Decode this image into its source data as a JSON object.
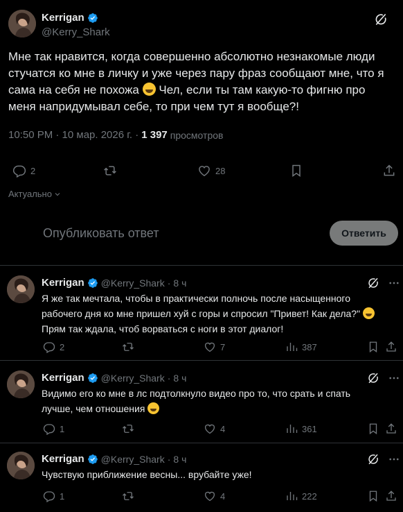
{
  "main_tweet": {
    "author_name": "Kerrigan",
    "author_handle": "@Kerry_Shark",
    "text": "Мне так нравится, когда совершенно абсолютно незнакомые люди стучатся ко мне в личку и уже через пару фраз сообщают мне, что я сама на себя не похожа",
    "text_after_emoji": " Чел, если ты там какую-то фигню про меня напридумывал себе, то при чем тут я вообще?!",
    "timestamp": "10:50 PM · 10 мар. 2026 г. · ",
    "views_count": "1 397",
    "views_label": "просмотров",
    "replies_count": "2",
    "reposts_count": "",
    "likes_count": "28"
  },
  "sort": {
    "label": "Актуально"
  },
  "reply_composer": {
    "placeholder": "Опубликовать ответ",
    "button_label": "Ответить"
  },
  "replies": [
    {
      "author_name": "Kerrigan",
      "author_handle": "@Kerry_Shark",
      "time": "8 ч",
      "text_line1": "Я же так мечтала, чтобы в практически полночь после насыщенного",
      "text_line2": "рабочего дня ко мне пришел хуй с горы и спросил \"Привет! Как дела?\"",
      "text_line3": "Прям так ждала, чтоб ворваться с ноги в этот диалог!",
      "replies_count": "2",
      "likes_count": "7",
      "views_count": "387"
    },
    {
      "author_name": "Kerrigan",
      "author_handle": "@Kerry_Shark",
      "time": "8 ч",
      "text_line1": "Видимо его ко мне в лс подтолкнуло видео про то, что срать и спать",
      "text_line2": "лучше, чем отношения",
      "replies_count": "1",
      "likes_count": "4",
      "views_count": "361"
    },
    {
      "author_name": "Kerrigan",
      "author_handle": "@Kerry_Shark",
      "time": "8 ч",
      "text_line1": "Чувствую приближение весны... врубайте уже!",
      "replies_count": "1",
      "likes_count": "4",
      "views_count": "222"
    }
  ],
  "colors": {
    "background": "#000000",
    "text_primary": "#e7e9ea",
    "text_secondary": "#71767b",
    "verified": "#1d9bf0",
    "divider": "#2f3336",
    "reply_button": "#787a7a"
  },
  "icons": {
    "verified": "verified-badge-icon",
    "grok": "grok-icon",
    "more": "more-icon",
    "reply": "reply-icon",
    "repost": "repost-icon",
    "like": "like-icon",
    "views": "views-icon",
    "bookmark": "bookmark-icon",
    "share": "share-icon",
    "chevron": "chevron-down-icon"
  }
}
